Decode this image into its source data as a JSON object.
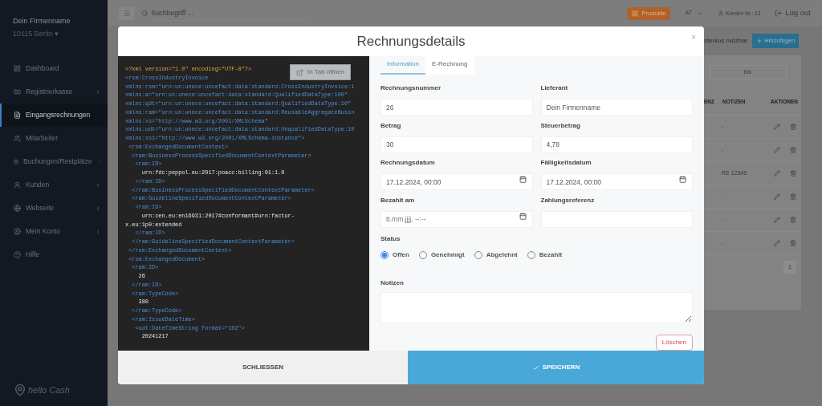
{
  "sidebar": {
    "company": "Dein Firmenname",
    "location": "10115 Berlin ▾",
    "items": [
      {
        "label": "Dashboard",
        "selected": false,
        "expandable": false
      },
      {
        "label": "Registrierkasse",
        "selected": false,
        "expandable": true
      },
      {
        "label": "Eingangsrechnungen",
        "selected": true,
        "expandable": false
      },
      {
        "label": "Mitarbeiter",
        "selected": false,
        "expandable": false
      },
      {
        "label": "Buchungen/Restplätze",
        "selected": false,
        "expandable": true
      },
      {
        "label": "Kunden",
        "selected": false,
        "expandable": true
      },
      {
        "label": "Webseite",
        "selected": false,
        "expandable": true
      },
      {
        "label": "Mein Konto",
        "selected": false,
        "expandable": true
      },
      {
        "label": "Hilfe",
        "selected": false,
        "expandable": false
      }
    ],
    "logo_text": "hello Cash"
  },
  "topbar": {
    "search_placeholder": "Suchbegriff ...",
    "products_button": "Produkte",
    "language": "AT",
    "customer_no": "Kunden Nr.: 23",
    "logout": "Log out"
  },
  "background": {
    "promo_text": "stenlos nutzbar",
    "add_button": "Hinzufügen",
    "date_filter": "bis",
    "columns": [
      "ENZ",
      "NOTIZEN",
      "AKTIONEN"
    ],
    "rows": [
      {
        "notes": "-"
      },
      {
        "notes": "-"
      },
      {
        "notes": "RE 12345"
      },
      {
        "notes": "-"
      },
      {
        "notes": "-"
      },
      {
        "notes": "-"
      }
    ],
    "pagination": [
      "1"
    ]
  },
  "modal": {
    "title": "Rechnungsdetails",
    "close": "×",
    "open_tab_button": "In Tab öffnen",
    "xml_lines": [
      {
        "kind": "decl",
        "text": "<?xml version=\"1.0\" encoding=\"UTF-8\"?>"
      },
      {
        "kind": "tag",
        "text": "<rsm:CrossIndustryInvoice"
      },
      {
        "kind": "tag",
        "text": "xmlns:rsm=\"urn:un:unece:uncefact:data:standard:CrossIndustryInvoice:1"
      },
      {
        "kind": "tag",
        "text": "xmlns:a=\"urn:un:unece:uncefact:data:standard:QualifiedDataType:100\""
      },
      {
        "kind": "tag",
        "text": "xmlns:qdt=\"urn:un:unece:uncefact:data:standard:QualifiedDataType:10\""
      },
      {
        "kind": "tag",
        "text": "xmlns:ram=\"urn:un:unece:uncefact:data:standard:ReusableAggregateBusin"
      },
      {
        "kind": "tag",
        "text": "xmlns:xs=\"http://www.w3.org/2001/XMLSchema\""
      },
      {
        "kind": "tag",
        "text": "xmlns:udt=\"urn:un:unece:uncefact:data:standard:UnqualifiedDataType:10"
      },
      {
        "kind": "tag",
        "text": "xmlns:xsi=\"http://www.w3.org/2001/XMLSchema-instance\">"
      },
      {
        "kind": "tag",
        "text": " <rsm:ExchangedDocumentContext>"
      },
      {
        "kind": "tag",
        "text": "  <ram:BusinessProcessSpecifiedDocumentContextParameter>"
      },
      {
        "kind": "tag",
        "text": "   <ram:ID>"
      },
      {
        "kind": "value",
        "text": "     urn:fdc:peppol.eu:2017:poacc:billing:01:1.0"
      },
      {
        "kind": "tag",
        "text": "   </ram:ID>"
      },
      {
        "kind": "tag",
        "text": "  </ram:BusinessProcessSpecifiedDocumentContextParameter>"
      },
      {
        "kind": "tag",
        "text": "  <ram:GuidelineSpecifiedDocumentContextParameter>"
      },
      {
        "kind": "tag",
        "text": "   <ram:ID>"
      },
      {
        "kind": "value",
        "text": "     urn:cen.eu:en16931:2017#conformant#urn:factur-"
      },
      {
        "kind": "value",
        "text": "x.eu:1p0:extended"
      },
      {
        "kind": "tag",
        "text": "   </ram:ID>"
      },
      {
        "kind": "tag",
        "text": "  </ram:GuidelineSpecifiedDocumentContextParameter>"
      },
      {
        "kind": "tag",
        "text": " </rsm:ExchangedDocumentContext>"
      },
      {
        "kind": "tag",
        "text": " <rsm:ExchangedDocument>"
      },
      {
        "kind": "tag",
        "text": "  <ram:ID>"
      },
      {
        "kind": "value",
        "text": "    26"
      },
      {
        "kind": "tag",
        "text": "  </ram:ID>"
      },
      {
        "kind": "tag",
        "text": "  <ram:TypeCode>"
      },
      {
        "kind": "value",
        "text": "    380"
      },
      {
        "kind": "tag",
        "text": "  </ram:TypeCode>"
      },
      {
        "kind": "tag",
        "text": "  <ram:IssueDateTime>"
      },
      {
        "kind": "tag",
        "text": "   <udt:DateTimeString format=\"102\">"
      },
      {
        "kind": "value",
        "text": "     20241217"
      }
    ],
    "tabs": [
      {
        "label": "Information",
        "selected": true
      },
      {
        "label": "E-Rechnung",
        "selected": false
      }
    ],
    "fields": [
      {
        "label": "Rechnungsnummer",
        "kind": "text",
        "value": "26"
      },
      {
        "label": "Lieferant",
        "kind": "text",
        "value": "Dein Firmenname"
      },
      {
        "label": "Betrag",
        "kind": "text",
        "value": "30"
      },
      {
        "label": "Steuerbetrag",
        "kind": "text",
        "value": "4,78"
      },
      {
        "label": "Rechnungsdatum",
        "kind": "datetime",
        "value": "17.12.2024, 00:00"
      },
      {
        "label": "Fälligkeitsdatum",
        "kind": "datetime",
        "value": "17.12.2024, 00:00"
      },
      {
        "label": "Bezahlt am",
        "kind": "datetime",
        "placeholder": "tt.mm.jjjj, --:--"
      },
      {
        "label": "Zahlungsreferenz",
        "kind": "text"
      }
    ],
    "status": {
      "label": "Status",
      "options": [
        {
          "label": "Offen",
          "selected": true
        },
        {
          "label": "Genehmigt",
          "selected": false
        },
        {
          "label": "Abgelehnt",
          "selected": false
        },
        {
          "label": "Bezahlt",
          "selected": false
        }
      ]
    },
    "notes_label": "Notizen",
    "delete_button": "Löschen",
    "close_button": "SCHLIESSEN",
    "save_button": "SPEICHERN"
  }
}
